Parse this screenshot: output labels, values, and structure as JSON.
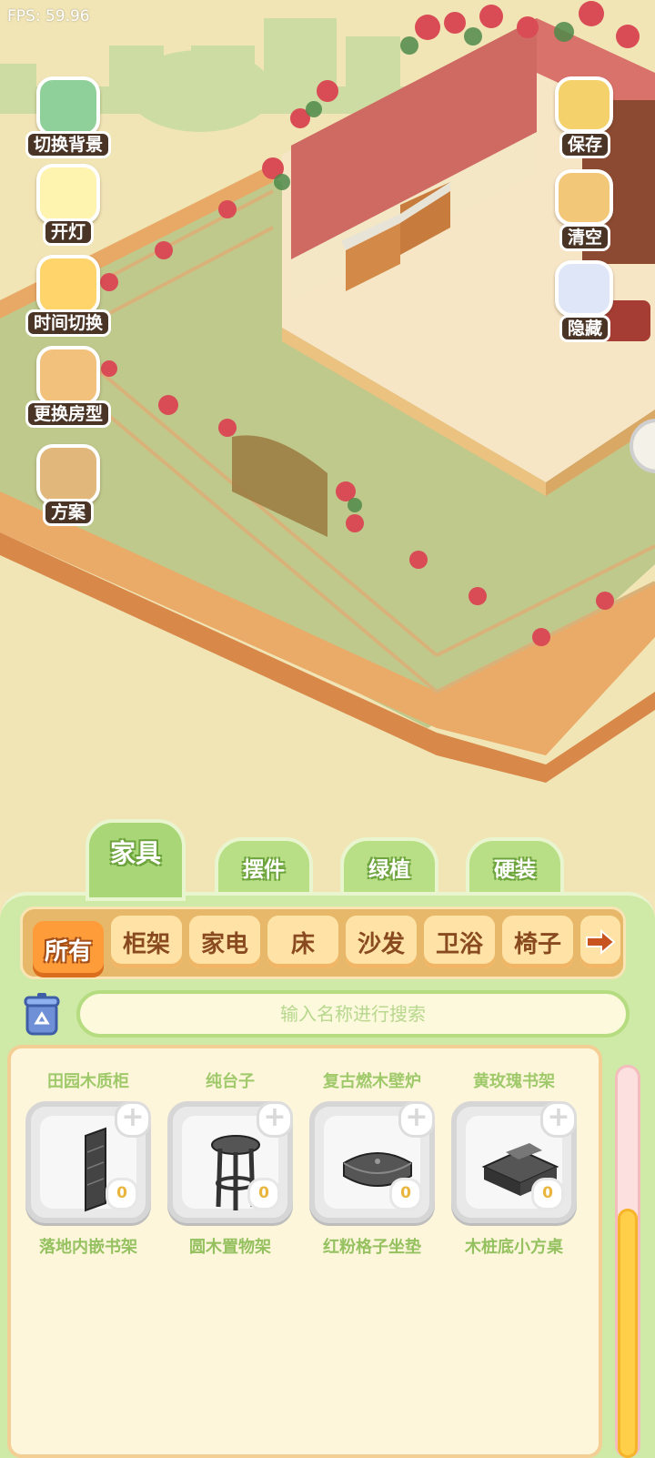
{
  "hud": {
    "fps": "FPS: 59.96"
  },
  "left_buttons": [
    {
      "label": "切换背景",
      "icon": "wallpaper-icon"
    },
    {
      "label": "开灯",
      "icon": "lamp-icon"
    },
    {
      "label": "时间切换",
      "icon": "sun-moon-icon"
    },
    {
      "label": "更换房型",
      "icon": "house-icon"
    },
    {
      "label": "方案",
      "icon": "folders-icon"
    }
  ],
  "right_buttons": [
    {
      "label": "保存",
      "icon": "duck-save-icon"
    },
    {
      "label": "清空",
      "icon": "duck-clear-icon"
    },
    {
      "label": "隐藏",
      "icon": "hide-icon"
    }
  ],
  "tabs": [
    "家具",
    "摆件",
    "绿植",
    "硬装"
  ],
  "active_tab": "家具",
  "categories": [
    "所有",
    "柜架",
    "家电",
    "床",
    "沙发",
    "卫浴",
    "椅子"
  ],
  "active_category": "所有",
  "search": {
    "placeholder": "输入名称进行搜索"
  },
  "items": [
    {
      "top_name": "田园木质柜",
      "name": "落地内嵌书架",
      "count": "0",
      "icon": "bookshelf-icon"
    },
    {
      "top_name": "纯台子",
      "name": "圆木置物架",
      "count": "0",
      "icon": "round-shelf-icon"
    },
    {
      "top_name": "复古燃木壁炉",
      "name": "红粉格子坐垫",
      "count": "0",
      "icon": "cushion-icon"
    },
    {
      "top_name": "黄玫瑰书架",
      "name": "木桩底小方桌",
      "count": "0",
      "icon": "square-table-icon"
    }
  ],
  "scroll": {
    "position": 0.38
  },
  "colors": {
    "panel_green": "#cfe9a6",
    "tab_green": "#a9d676",
    "category_orange": "#ff9c3a",
    "scene_ground": "#b9c38a",
    "wall_pink": "#d9726a"
  }
}
